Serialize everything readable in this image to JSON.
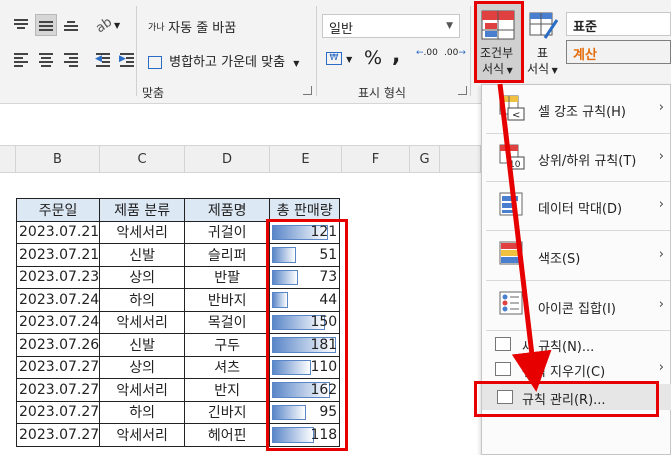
{
  "ribbon": {
    "wrap_text": "자동 줄 바꿈",
    "wrap_icon_text": "가나",
    "merge_center": "병합하고 가운데 맞춤",
    "alignment_group": "맞춤",
    "number_format": "일반",
    "number_group": "표시 형식",
    "percent_symbol": "%",
    "comma_symbol": ",",
    "inc_decimal": ".00",
    "dec_decimal": ".00",
    "cf_label_1": "조건부",
    "cf_label_2": "서식",
    "table_label_1": "표",
    "table_label_2": "서식",
    "style_normal": "표준",
    "style_calc": "계산"
  },
  "columns": [
    "B",
    "C",
    "D",
    "E",
    "F",
    "G"
  ],
  "table": {
    "headers": [
      "주문일",
      "제품 분류",
      "제품명",
      "총 판매량"
    ],
    "rows": [
      {
        "date": "2023.07.21",
        "cat": "악세서리",
        "prod": "귀걸이",
        "qty": "121",
        "bar": 0.87
      },
      {
        "date": "2023.07.21",
        "cat": "신발",
        "prod": "슬리퍼",
        "qty": "51",
        "bar": 0.37
      },
      {
        "date": "2023.07.23",
        "cat": "상의",
        "prod": "반팔",
        "qty": "73",
        "bar": 0.4
      },
      {
        "date": "2023.07.24",
        "cat": "하의",
        "prod": "반바지",
        "qty": "44",
        "bar": 0.24
      },
      {
        "date": "2023.07.24",
        "cat": "악세서리",
        "prod": "목걸이",
        "qty": "150",
        "bar": 0.83
      },
      {
        "date": "2023.07.26",
        "cat": "신발",
        "prod": "구두",
        "qty": "181",
        "bar": 1.0
      },
      {
        "date": "2023.07.27",
        "cat": "상의",
        "prod": "셔츠",
        "qty": "110",
        "bar": 0.61
      },
      {
        "date": "2023.07.27",
        "cat": "악세서리",
        "prod": "반지",
        "qty": "162",
        "bar": 0.9
      },
      {
        "date": "2023.07.27",
        "cat": "하의",
        "prod": "긴바지",
        "qty": "95",
        "bar": 0.53
      },
      {
        "date": "2023.07.27",
        "cat": "악세서리",
        "prod": "헤어핀",
        "qty": "118",
        "bar": 0.65
      }
    ]
  },
  "menu": {
    "highlight_rules": "셀 강조 규칙(H)",
    "top_bottom": "상위/하위 규칙(T)",
    "data_bars": "데이터 막대(D)",
    "color_scales": "색조(S)",
    "icon_sets": "아이콘 집합(I)",
    "new_rule": "새 규칙(N)...",
    "clear_rules": "규칙 지우기(C)",
    "manage_rules": "규칙 관리(R)...",
    "icon_text_lt": "<",
    "icon_text_10": "10"
  },
  "colors": {
    "highlight_red": "#e60000",
    "bar_blue": "#5a86c8",
    "header_fill": "#dde8f5",
    "calc_orange": "#e46c0a"
  }
}
